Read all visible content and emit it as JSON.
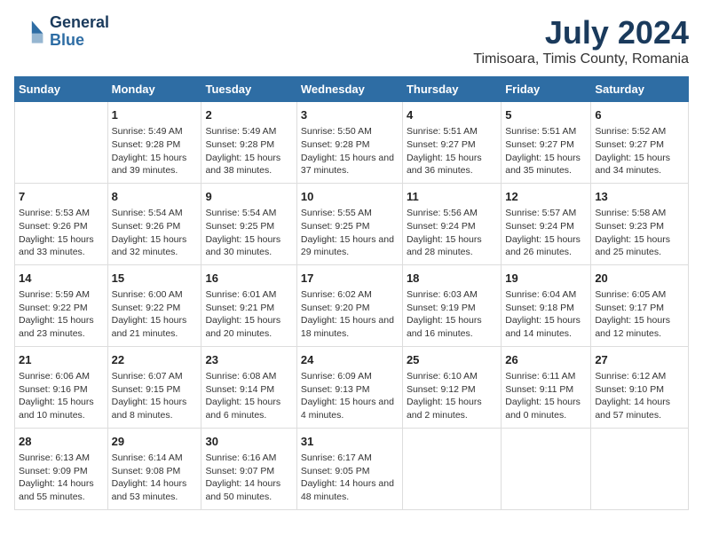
{
  "header": {
    "logo_line1": "General",
    "logo_line2": "Blue",
    "month": "July 2024",
    "location": "Timisoara, Timis County, Romania"
  },
  "days_of_week": [
    "Sunday",
    "Monday",
    "Tuesday",
    "Wednesday",
    "Thursday",
    "Friday",
    "Saturday"
  ],
  "weeks": [
    [
      {
        "num": "",
        "sunrise": "",
        "sunset": "",
        "daylight": ""
      },
      {
        "num": "1",
        "sunrise": "Sunrise: 5:49 AM",
        "sunset": "Sunset: 9:28 PM",
        "daylight": "Daylight: 15 hours and 39 minutes."
      },
      {
        "num": "2",
        "sunrise": "Sunrise: 5:49 AM",
        "sunset": "Sunset: 9:28 PM",
        "daylight": "Daylight: 15 hours and 38 minutes."
      },
      {
        "num": "3",
        "sunrise": "Sunrise: 5:50 AM",
        "sunset": "Sunset: 9:28 PM",
        "daylight": "Daylight: 15 hours and 37 minutes."
      },
      {
        "num": "4",
        "sunrise": "Sunrise: 5:51 AM",
        "sunset": "Sunset: 9:27 PM",
        "daylight": "Daylight: 15 hours and 36 minutes."
      },
      {
        "num": "5",
        "sunrise": "Sunrise: 5:51 AM",
        "sunset": "Sunset: 9:27 PM",
        "daylight": "Daylight: 15 hours and 35 minutes."
      },
      {
        "num": "6",
        "sunrise": "Sunrise: 5:52 AM",
        "sunset": "Sunset: 9:27 PM",
        "daylight": "Daylight: 15 hours and 34 minutes."
      }
    ],
    [
      {
        "num": "7",
        "sunrise": "Sunrise: 5:53 AM",
        "sunset": "Sunset: 9:26 PM",
        "daylight": "Daylight: 15 hours and 33 minutes."
      },
      {
        "num": "8",
        "sunrise": "Sunrise: 5:54 AM",
        "sunset": "Sunset: 9:26 PM",
        "daylight": "Daylight: 15 hours and 32 minutes."
      },
      {
        "num": "9",
        "sunrise": "Sunrise: 5:54 AM",
        "sunset": "Sunset: 9:25 PM",
        "daylight": "Daylight: 15 hours and 30 minutes."
      },
      {
        "num": "10",
        "sunrise": "Sunrise: 5:55 AM",
        "sunset": "Sunset: 9:25 PM",
        "daylight": "Daylight: 15 hours and 29 minutes."
      },
      {
        "num": "11",
        "sunrise": "Sunrise: 5:56 AM",
        "sunset": "Sunset: 9:24 PM",
        "daylight": "Daylight: 15 hours and 28 minutes."
      },
      {
        "num": "12",
        "sunrise": "Sunrise: 5:57 AM",
        "sunset": "Sunset: 9:24 PM",
        "daylight": "Daylight: 15 hours and 26 minutes."
      },
      {
        "num": "13",
        "sunrise": "Sunrise: 5:58 AM",
        "sunset": "Sunset: 9:23 PM",
        "daylight": "Daylight: 15 hours and 25 minutes."
      }
    ],
    [
      {
        "num": "14",
        "sunrise": "Sunrise: 5:59 AM",
        "sunset": "Sunset: 9:22 PM",
        "daylight": "Daylight: 15 hours and 23 minutes."
      },
      {
        "num": "15",
        "sunrise": "Sunrise: 6:00 AM",
        "sunset": "Sunset: 9:22 PM",
        "daylight": "Daylight: 15 hours and 21 minutes."
      },
      {
        "num": "16",
        "sunrise": "Sunrise: 6:01 AM",
        "sunset": "Sunset: 9:21 PM",
        "daylight": "Daylight: 15 hours and 20 minutes."
      },
      {
        "num": "17",
        "sunrise": "Sunrise: 6:02 AM",
        "sunset": "Sunset: 9:20 PM",
        "daylight": "Daylight: 15 hours and 18 minutes."
      },
      {
        "num": "18",
        "sunrise": "Sunrise: 6:03 AM",
        "sunset": "Sunset: 9:19 PM",
        "daylight": "Daylight: 15 hours and 16 minutes."
      },
      {
        "num": "19",
        "sunrise": "Sunrise: 6:04 AM",
        "sunset": "Sunset: 9:18 PM",
        "daylight": "Daylight: 15 hours and 14 minutes."
      },
      {
        "num": "20",
        "sunrise": "Sunrise: 6:05 AM",
        "sunset": "Sunset: 9:17 PM",
        "daylight": "Daylight: 15 hours and 12 minutes."
      }
    ],
    [
      {
        "num": "21",
        "sunrise": "Sunrise: 6:06 AM",
        "sunset": "Sunset: 9:16 PM",
        "daylight": "Daylight: 15 hours and 10 minutes."
      },
      {
        "num": "22",
        "sunrise": "Sunrise: 6:07 AM",
        "sunset": "Sunset: 9:15 PM",
        "daylight": "Daylight: 15 hours and 8 minutes."
      },
      {
        "num": "23",
        "sunrise": "Sunrise: 6:08 AM",
        "sunset": "Sunset: 9:14 PM",
        "daylight": "Daylight: 15 hours and 6 minutes."
      },
      {
        "num": "24",
        "sunrise": "Sunrise: 6:09 AM",
        "sunset": "Sunset: 9:13 PM",
        "daylight": "Daylight: 15 hours and 4 minutes."
      },
      {
        "num": "25",
        "sunrise": "Sunrise: 6:10 AM",
        "sunset": "Sunset: 9:12 PM",
        "daylight": "Daylight: 15 hours and 2 minutes."
      },
      {
        "num": "26",
        "sunrise": "Sunrise: 6:11 AM",
        "sunset": "Sunset: 9:11 PM",
        "daylight": "Daylight: 15 hours and 0 minutes."
      },
      {
        "num": "27",
        "sunrise": "Sunrise: 6:12 AM",
        "sunset": "Sunset: 9:10 PM",
        "daylight": "Daylight: 14 hours and 57 minutes."
      }
    ],
    [
      {
        "num": "28",
        "sunrise": "Sunrise: 6:13 AM",
        "sunset": "Sunset: 9:09 PM",
        "daylight": "Daylight: 14 hours and 55 minutes."
      },
      {
        "num": "29",
        "sunrise": "Sunrise: 6:14 AM",
        "sunset": "Sunset: 9:08 PM",
        "daylight": "Daylight: 14 hours and 53 minutes."
      },
      {
        "num": "30",
        "sunrise": "Sunrise: 6:16 AM",
        "sunset": "Sunset: 9:07 PM",
        "daylight": "Daylight: 14 hours and 50 minutes."
      },
      {
        "num": "31",
        "sunrise": "Sunrise: 6:17 AM",
        "sunset": "Sunset: 9:05 PM",
        "daylight": "Daylight: 14 hours and 48 minutes."
      },
      {
        "num": "",
        "sunrise": "",
        "sunset": "",
        "daylight": ""
      },
      {
        "num": "",
        "sunrise": "",
        "sunset": "",
        "daylight": ""
      },
      {
        "num": "",
        "sunrise": "",
        "sunset": "",
        "daylight": ""
      }
    ]
  ]
}
